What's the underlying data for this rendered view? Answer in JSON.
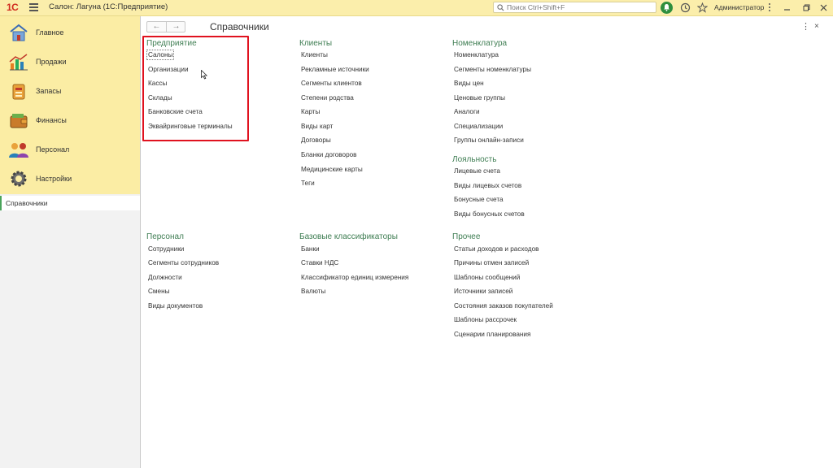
{
  "titlebar": {
    "logo": "1С",
    "title": "Салон: Лагуна  (1С:Предприятие)",
    "search_placeholder": "Поиск Ctrl+Shift+F",
    "user": "Администратор"
  },
  "sidebar": {
    "sections": [
      {
        "label": "Главное",
        "icon": "home-icon"
      },
      {
        "label": "Продажи",
        "icon": "sales-chart-icon"
      },
      {
        "label": "Запасы",
        "icon": "stock-box-icon"
      },
      {
        "label": "Финансы",
        "icon": "wallet-icon"
      },
      {
        "label": "Персонал",
        "icon": "people-icon"
      },
      {
        "label": "Настройки",
        "icon": "gear-icon"
      }
    ],
    "open_window": "Справочники"
  },
  "page": {
    "title": "Справочники"
  },
  "groups": {
    "enterprise": {
      "title": "Предприятие",
      "items": [
        "Салоны",
        "Организации",
        "Кассы",
        "Склады",
        "Банковские счета",
        "Эквайринговые терминалы"
      ]
    },
    "clients": {
      "title": "Клиенты",
      "items": [
        "Клиенты",
        "Рекламные источники",
        "Сегменты клиентов",
        "Степени родства",
        "Карты",
        "Виды карт",
        "Договоры",
        "Бланки договоров",
        "Медицинские карты",
        "Теги"
      ]
    },
    "nomenclature": {
      "title": "Номенклатура",
      "items": [
        "Номенклатура",
        "Сегменты номенклатуры",
        "Виды цен",
        "Ценовые группы",
        "Аналоги",
        "Специализации",
        "Группы онлайн-записи"
      ]
    },
    "loyalty": {
      "title": "Лояльность",
      "items": [
        "Лицевые счета",
        "Виды лицевых счетов",
        "Бонусные счета",
        "Виды бонусных счетов"
      ]
    },
    "personnel": {
      "title": "Персонал",
      "items": [
        "Сотрудники",
        "Сегменты сотрудников",
        "Должности",
        "Смены",
        "Виды документов"
      ]
    },
    "classifiers": {
      "title": "Базовые классификаторы",
      "items": [
        "Банки",
        "Ставки НДС",
        "Классификатор единиц измерения",
        "Валюты"
      ]
    },
    "other": {
      "title": "Прочее",
      "items": [
        "Статьи доходов и расходов",
        "Причины отмен записей",
        "Шаблоны сообщений",
        "Источники записей",
        "Состояния заказов покупателей",
        "Шаблоны рассрочек",
        "Сценарии планирования"
      ]
    }
  },
  "colors": {
    "titlebar_bg": "#fbeeab",
    "sections_bg": "#fbeda4",
    "group_title": "#3e7d52",
    "highlight_box": "#e0121f"
  }
}
